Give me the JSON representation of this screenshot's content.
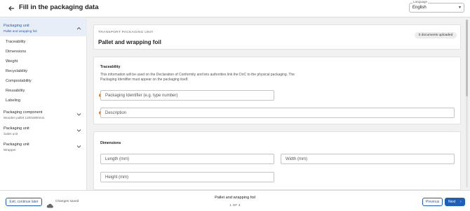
{
  "header": {
    "title": "Fill in the packaging data",
    "language_label": "Language",
    "language_value": "English"
  },
  "sidebar": {
    "groups": [
      {
        "title": "Packaging unit",
        "subtitle": "Pallet and wrapping foil",
        "expanded": true
      },
      {
        "title": "Packaging component",
        "subtitle": "Wooden pallet 1200x800mm",
        "expanded": false
      },
      {
        "title": "Packaging unit",
        "subtitle": "Sales unit",
        "expanded": false
      },
      {
        "title": "Packaging unit",
        "subtitle": "Wrapper",
        "expanded": false
      }
    ],
    "sub_items": [
      "Traceability",
      "Dimensions",
      "Weight",
      "Recyclability",
      "Compostability",
      "Reusability",
      "Labeling"
    ]
  },
  "main": {
    "kicker": "TRANSPORT PACKAGING UNIT",
    "title": "Pallet and wrapping foil",
    "documents_badge": "0 documents uploaded",
    "traceability": {
      "title": "Traceability",
      "description": "This information will be used on the Declaration of Conformity and lets authorities link the DoC to the physical packaging. The Packaging Identifier must appear on the packaging itself.",
      "fields": [
        "Packaging Identifier (e.g. type number)",
        "Description"
      ]
    },
    "dimensions": {
      "title": "Dimensions",
      "fields": [
        "Length (mm)",
        "Width (mm)",
        "Height (mm)"
      ]
    }
  },
  "footer": {
    "exit_label": "Exit, continue later",
    "saved_label": "Changes saved",
    "center_title": "Pallet and wrapping foil",
    "center_sub": "1 OF 4",
    "previous_label": "Previous",
    "next_label": "Next"
  },
  "colors": {
    "accent": "#1f5fb8",
    "required": "#e87722",
    "active_bg": "#e8eef8"
  },
  "icons": {
    "back": "arrow-left-icon",
    "language_caret": "caret-down-icon",
    "chevron_up": "chevron-up-icon",
    "chevron_down": "chevron-down-icon",
    "cloud": "cloud-icon",
    "next_arrow": "chevron-right-icon"
  }
}
